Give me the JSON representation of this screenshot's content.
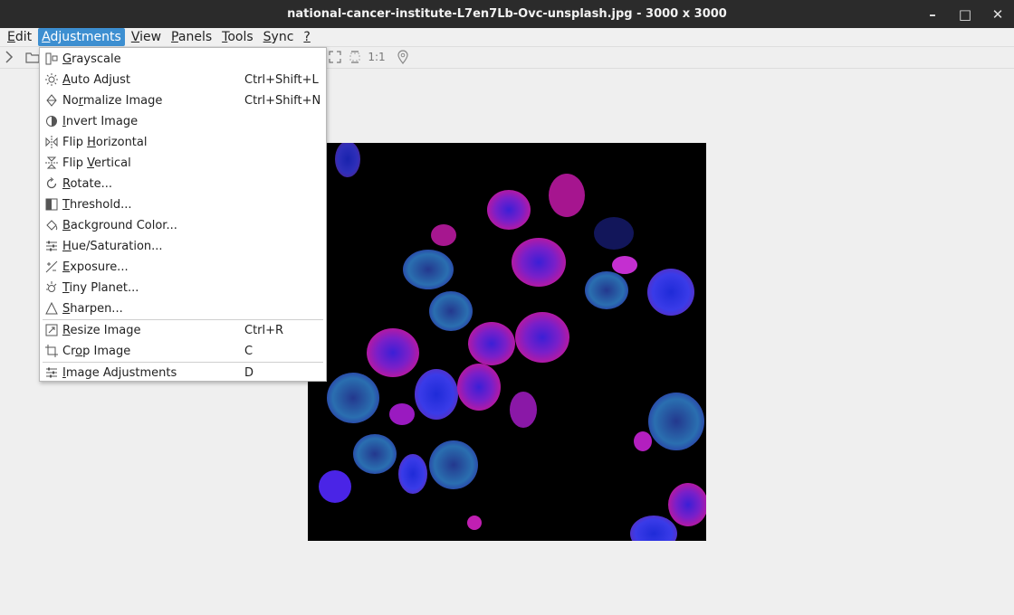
{
  "window": {
    "title": "national-cancer-institute-L7en7Lb-Ovc-unsplash.jpg  - 3000 x 3000",
    "controls": {
      "minimize": "–",
      "maximize": "□",
      "close": "✕"
    }
  },
  "menubar": {
    "items": [
      {
        "pre": "",
        "acc": "E",
        "post": "dit"
      },
      {
        "pre": "",
        "acc": "A",
        "post": "djustments"
      },
      {
        "pre": "",
        "acc": "V",
        "post": "iew"
      },
      {
        "pre": "",
        "acc": "P",
        "post": "anels"
      },
      {
        "pre": "",
        "acc": "T",
        "post": "ools"
      },
      {
        "pre": "",
        "acc": "S",
        "post": "ync"
      },
      {
        "pre": "",
        "acc": "?",
        "post": ""
      }
    ],
    "active_index": 1
  },
  "toolbar": {
    "icons": [
      "chevron-right-icon",
      "folder-icon",
      "fit-screen-icon",
      "fit-width-icon",
      "actual-size-icon",
      "location-pin-icon"
    ],
    "actual_size_label": "1:1"
  },
  "menu": {
    "items": [
      {
        "type": "item",
        "icon": "grayscale-icon",
        "pre": "",
        "acc": "G",
        "post": "rayscale",
        "shortcut": ""
      },
      {
        "type": "item",
        "icon": "sun-icon",
        "pre": "",
        "acc": "A",
        "post": "uto Adjust",
        "shortcut": "Ctrl+Shift+L"
      },
      {
        "type": "item",
        "icon": "normalize-icon",
        "pre": "No",
        "acc": "r",
        "post": "malize Image",
        "shortcut": "Ctrl+Shift+N"
      },
      {
        "type": "item",
        "icon": "invert-icon",
        "pre": "",
        "acc": "I",
        "post": "nvert Image",
        "shortcut": ""
      },
      {
        "type": "item",
        "icon": "flip-horizontal-icon",
        "pre": "Flip ",
        "acc": "H",
        "post": "orizontal",
        "shortcut": ""
      },
      {
        "type": "item",
        "icon": "flip-vertical-icon",
        "pre": "Flip ",
        "acc": "V",
        "post": "ertical",
        "shortcut": ""
      },
      {
        "type": "item",
        "icon": "rotate-icon",
        "pre": "",
        "acc": "R",
        "post": "otate...",
        "shortcut": ""
      },
      {
        "type": "item",
        "icon": "threshold-icon",
        "pre": "",
        "acc": "T",
        "post": "hreshold...",
        "shortcut": ""
      },
      {
        "type": "item",
        "icon": "paint-bucket-icon",
        "pre": "",
        "acc": "B",
        "post": "ackground Color...",
        "shortcut": ""
      },
      {
        "type": "item",
        "icon": "sliders-icon",
        "pre": "",
        "acc": "H",
        "post": "ue/Saturation...",
        "shortcut": ""
      },
      {
        "type": "item",
        "icon": "exposure-icon",
        "pre": "",
        "acc": "E",
        "post": "xposure...",
        "shortcut": ""
      },
      {
        "type": "item",
        "icon": "tiny-planet-icon",
        "pre": "",
        "acc": "T",
        "post": "iny Planet...",
        "shortcut": ""
      },
      {
        "type": "item",
        "icon": "sharpen-icon",
        "pre": "",
        "acc": "S",
        "post": "harpen...",
        "shortcut": ""
      },
      {
        "type": "sep"
      },
      {
        "type": "item",
        "icon": "resize-icon",
        "pre": "",
        "acc": "R",
        "post": "esize Image",
        "shortcut": "Ctrl+R"
      },
      {
        "type": "item",
        "icon": "crop-icon",
        "pre": "Cr",
        "acc": "o",
        "post": "p Image",
        "shortcut": "C"
      },
      {
        "type": "sep"
      },
      {
        "type": "item",
        "icon": "sliders-icon",
        "pre": "",
        "acc": "I",
        "post": "mage Adjustments",
        "shortcut": "D"
      }
    ]
  },
  "colors": {
    "titlebar": "#2b2b2b",
    "menu_active": "#3d8fd1",
    "canvas_bg": "#efefef",
    "image_bg": "#000000"
  }
}
